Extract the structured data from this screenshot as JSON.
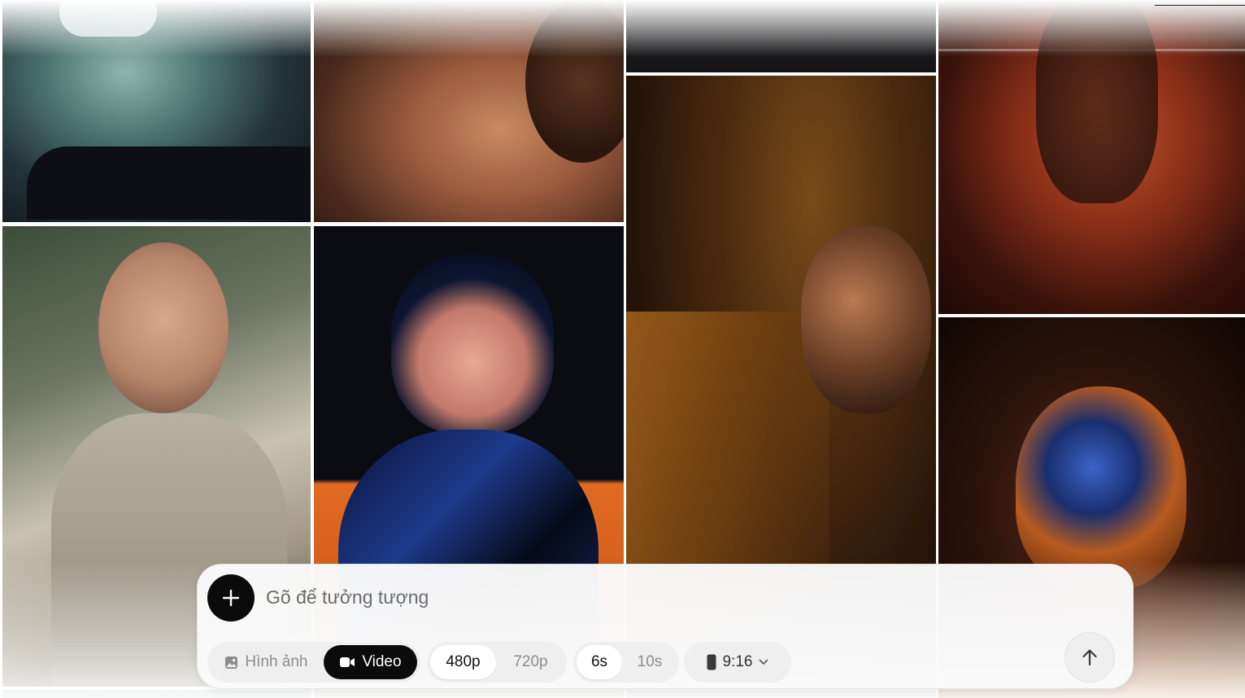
{
  "gallery": {
    "tiles": [
      {
        "name": "gallery-tile-glass-chair"
      },
      {
        "name": "gallery-tile-woman-neck"
      },
      {
        "name": "gallery-tile-dark-fur"
      },
      {
        "name": "gallery-tile-runner-dust"
      },
      {
        "name": "gallery-tile-woman-flowers"
      },
      {
        "name": "gallery-tile-anime-girl"
      },
      {
        "name": "gallery-tile-bar-woman"
      },
      {
        "name": "gallery-tile-chrome-head"
      }
    ]
  },
  "composer": {
    "placeholder": "Gõ để tưởng tượng",
    "mode": {
      "image_label": "Hình ảnh",
      "video_label": "Video",
      "selected": "Video"
    },
    "resolution": {
      "options": [
        "480p",
        "720p"
      ],
      "selected": "480p"
    },
    "duration": {
      "options": [
        "6s",
        "10s"
      ],
      "selected": "6s"
    },
    "aspect_ratio": {
      "value": "9:16"
    }
  },
  "icons": {
    "add": "plus-icon",
    "image_mode": "image-icon",
    "video_mode": "video-camera-icon",
    "ratio": "portrait-rectangle-icon",
    "dropdown": "chevron-down-icon",
    "send": "arrow-up-icon"
  },
  "colors": {
    "accent_dark": "#0b0b0b",
    "pill_bg": "#efefef",
    "muted_text": "#8d8d8d"
  }
}
